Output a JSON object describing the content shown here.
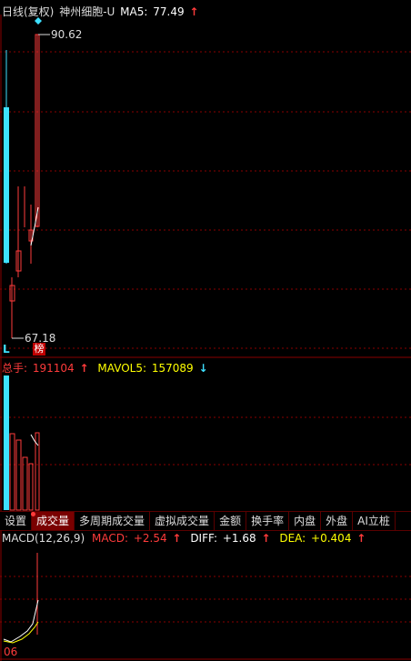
{
  "price_panel": {
    "title": "日线(复权)",
    "stock_name": "神州细胞-U",
    "ma_label": "MA5:",
    "ma_value": "77.49",
    "high_label": "90.62",
    "low_label": "67.18",
    "marker_L": "L",
    "marker_bang": "榜"
  },
  "volume_panel": {
    "vol_label": "总手:",
    "vol_value": "191104",
    "mavol_label": "MAVOL5:",
    "mavol_value": "157089"
  },
  "tabs": [
    {
      "label": "设置",
      "active": false
    },
    {
      "label": "成交量",
      "active": true
    },
    {
      "label": "多周期成交量",
      "active": false
    },
    {
      "label": "虚拟成交量",
      "active": false
    },
    {
      "label": "金额",
      "active": false
    },
    {
      "label": "换手率",
      "active": false
    },
    {
      "label": "内盘",
      "active": false
    },
    {
      "label": "外盘",
      "active": false
    },
    {
      "label": "AI立桩",
      "active": false
    }
  ],
  "macd_panel": {
    "macd_title": "MACD(12,26,9)",
    "macd_label": "MACD:",
    "macd_value": "+2.54",
    "diff_label": "DIFF:",
    "diff_value": "+1.68",
    "dea_label": "DEA:",
    "dea_value": "+0.404",
    "bottom_label": "06"
  },
  "colors": {
    "up": "#ff3b3b",
    "down": "#3ee0ff",
    "grid": "#8a0000",
    "ma": "#ffffff",
    "yellow": "#ffff00"
  }
}
